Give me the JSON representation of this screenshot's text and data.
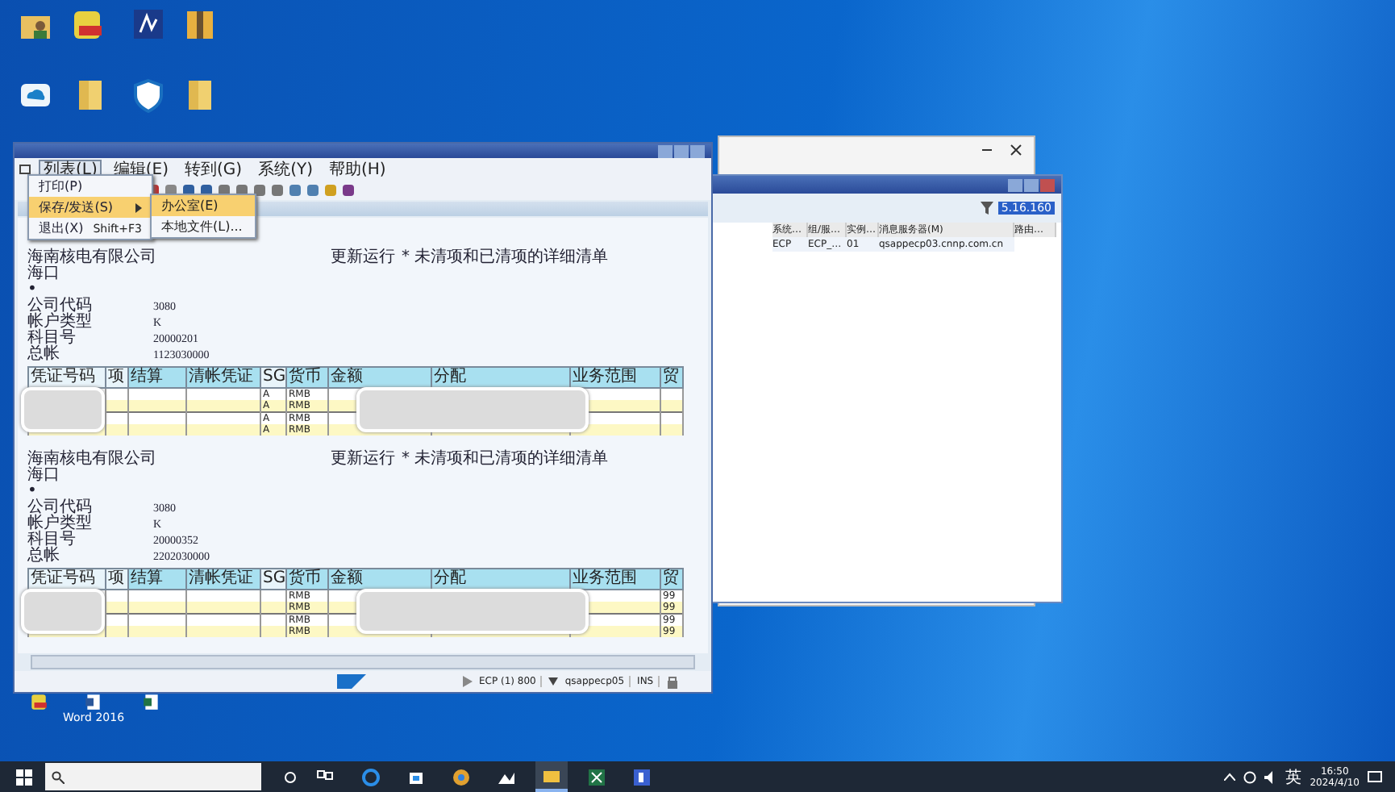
{
  "desktop": {
    "icons": [
      {
        "kind": "user-folder"
      },
      {
        "kind": "tool"
      },
      {
        "kind": "app"
      },
      {
        "kind": "archive"
      },
      {
        "kind": "cloud"
      },
      {
        "kind": "folder"
      },
      {
        "kind": "shield"
      },
      {
        "kind": "folder"
      },
      {
        "kind": "tool"
      },
      {
        "kind": "word",
        "label": "Word 2016"
      },
      {
        "kind": "excel"
      }
    ]
  },
  "back_window": {
    "filter_value": "5.16.160",
    "columns": [
      "系统…",
      "组/服…",
      "实例…",
      "消息服务器(M)",
      "路由…"
    ],
    "rows": [
      {
        "cells": [
          "ECP",
          "ECP_…",
          "01",
          "qsappecp03.cnnp.com.cn"
        ]
      }
    ]
  },
  "sap_window": {
    "menu": [
      {
        "label": "列表(L)",
        "selected": true
      },
      {
        "label": "编辑(E)",
        "selected": false
      },
      {
        "label": "转到(G)",
        "selected": false
      },
      {
        "label": "系统(Y)",
        "selected": false
      },
      {
        "label": "帮助(H)",
        "selected": false
      }
    ],
    "dropdown": [
      {
        "label": "打印(P)",
        "selected": false,
        "submenu": false
      },
      {
        "label": "保存/发送(S)",
        "selected": true,
        "submenu": true
      },
      {
        "label": "退出(X)",
        "shortcut": "Shift+F3",
        "selected": false,
        "submenu": false
      }
    ],
    "submenu": [
      {
        "label": "办公室(E)",
        "selected": true
      },
      {
        "label": "本地文件(L)...",
        "selected": false
      }
    ],
    "reports": [
      {
        "company": "海南核电有限公司",
        "city": "海口",
        "marker": "•",
        "title": "更新运行",
        "subtitle": "* 未清项和已清项的详细清单",
        "fields": [
          {
            "label": "公司代码",
            "value": "3080"
          },
          {
            "label": "帐户类型",
            "value": "K"
          },
          {
            "label": "科目号",
            "value": "20000201"
          },
          {
            "label": "总帐",
            "value": "1123030000"
          }
        ],
        "columns": [
          "凭证号码",
          "项",
          "结算",
          "清帐凭证",
          "SG",
          "货币",
          "金额",
          "分配",
          "业务范围",
          "贸"
        ],
        "rows": [
          {
            "sg": "A",
            "currency": "RMB",
            "highlighted": false
          },
          {
            "sg": "A",
            "currency": "RMB",
            "highlighted": true
          },
          {
            "sg": "A",
            "currency": "RMB",
            "highlighted": false
          },
          {
            "sg": "A",
            "currency": "RMB",
            "highlighted": true
          }
        ]
      },
      {
        "company": "海南核电有限公司",
        "city": "海口",
        "marker": "•",
        "title": "更新运行",
        "subtitle": "* 未清项和已清项的详细清单",
        "fields": [
          {
            "label": "公司代码",
            "value": "3080"
          },
          {
            "label": "帐户类型",
            "value": "K"
          },
          {
            "label": "科目号",
            "value": "20000352"
          },
          {
            "label": "总帐",
            "value": "2202030000"
          }
        ],
        "columns": [
          "凭证号码",
          "项",
          "结算",
          "清帐凭证",
          "SG",
          "货币",
          "金额",
          "分配",
          "业务范围",
          "贸"
        ],
        "rows": [
          {
            "currency": "RMB",
            "column_10": "99",
            "highlighted": false
          },
          {
            "currency": "RMB",
            "column_10": "99",
            "highlighted": true
          },
          {
            "currency": "RMB",
            "column_10": "99",
            "highlighted": false
          },
          {
            "currency": "RMB",
            "column_10": "99",
            "highlighted": true
          }
        ]
      }
    ],
    "status": {
      "system": "ECP (1) 800",
      "server": "qsappecp05",
      "mode": "INS"
    }
  },
  "taskbar": {
    "apps": [
      {
        "kind": "task-view",
        "selected": false
      },
      {
        "kind": "edge",
        "selected": false
      },
      {
        "kind": "store",
        "selected": false
      },
      {
        "kind": "chrome",
        "selected": false
      },
      {
        "kind": "photos",
        "selected": false
      },
      {
        "kind": "explorer",
        "selected": true
      },
      {
        "kind": "excel",
        "selected": false
      },
      {
        "kind": "r-app",
        "selected": false
      }
    ],
    "ime": "英",
    "time": "16:50",
    "date": "2024/4/10"
  }
}
